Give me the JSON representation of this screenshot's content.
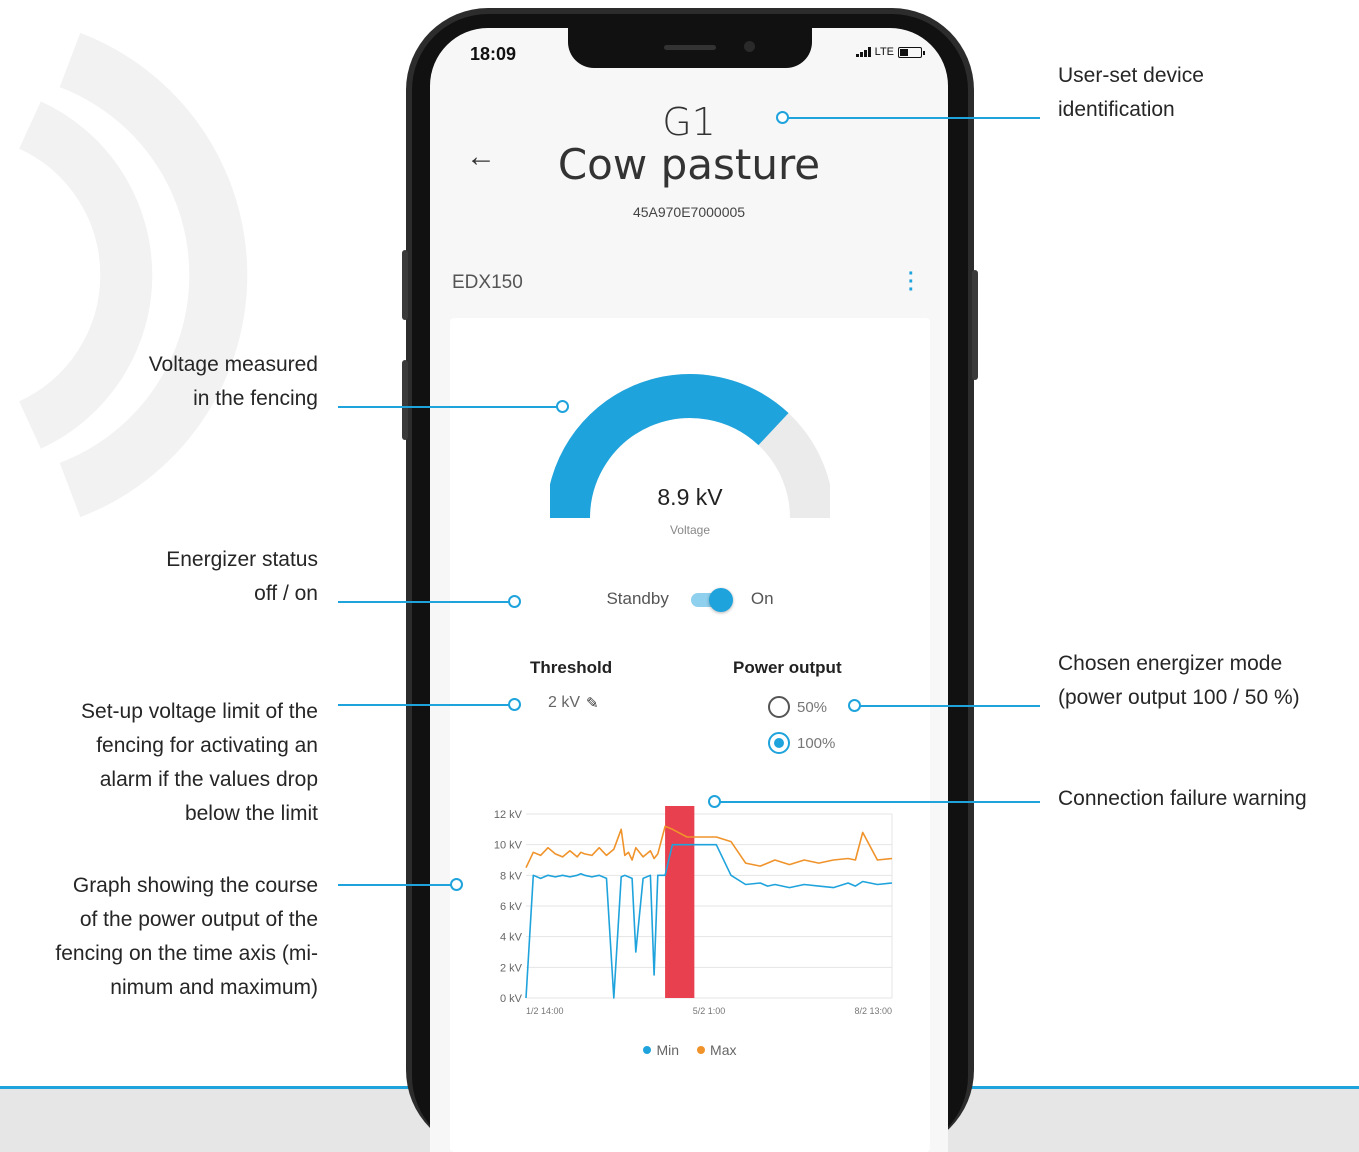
{
  "annotations": {
    "device_id": "User-set device\nidentification",
    "voltage": "Voltage measured\nin the fencing",
    "status": "Energizer status\noff / on",
    "threshold": "Set-up voltage limit of the\nfencing for activating an\nalarm if the values drop\nbelow the limit",
    "graph": "Graph showing the course\nof the power output of the\nfencing on the time axis (mi-\nnimum and maximum)",
    "mode": "Chosen energizer mode\n(power output 100 / 50 %)",
    "failure": "Connection failure warning"
  },
  "status_bar": {
    "time": "18:09",
    "network": "LTE"
  },
  "header": {
    "back_icon": "arrow-left-icon",
    "device_id": "G1",
    "device_name": "Cow pasture",
    "serial": "45A970E7000005"
  },
  "device": {
    "model": "EDX150",
    "menu_icon": "more-vertical-icon"
  },
  "gauge": {
    "value": "8.9 kV",
    "label": "Voltage",
    "fraction": 0.74
  },
  "energizer": {
    "off_label": "Standby",
    "on_label": "On",
    "state": "on"
  },
  "threshold": {
    "title": "Threshold",
    "value": "2 kV",
    "icon": "pencil-icon"
  },
  "power_output": {
    "title": "Power output",
    "options": [
      "50%",
      "100%"
    ],
    "selected": "100%"
  },
  "colors": {
    "accent": "#1fa3dc",
    "max": "#f0932b",
    "warning": "#e8404f",
    "gauge_track": "#ebebeb"
  },
  "chart_data": {
    "type": "line",
    "y_ticks": [
      "12 kV",
      "10 kV",
      "8 kV",
      "6 kV",
      "4 kV",
      "2 kV",
      "0 kV"
    ],
    "ylim": [
      0,
      12
    ],
    "x_ticks": [
      "1/2 14:00",
      "5/2 1:00",
      "8/2 13:00"
    ],
    "x": [
      0,
      2,
      4,
      6,
      8,
      10,
      12,
      14,
      15,
      16,
      18,
      20,
      22,
      24,
      26,
      27,
      28,
      29,
      30,
      32,
      34,
      35,
      36,
      38,
      40,
      44,
      48,
      52,
      56,
      60,
      64,
      66,
      68,
      72,
      76,
      80,
      84,
      88,
      90,
      92,
      96,
      100
    ],
    "series": [
      {
        "name": "Min",
        "values": [
          0,
          8,
          7.8,
          8,
          7.9,
          8,
          7.9,
          8,
          8.1,
          8,
          7.9,
          8,
          7.8,
          0,
          7.9,
          8,
          7.9,
          7.8,
          3,
          7.8,
          8,
          1.5,
          8,
          8,
          10,
          10,
          10,
          10,
          8,
          7.4,
          7.5,
          7.3,
          7.4,
          7.2,
          7.4,
          7.3,
          7.2,
          7.5,
          7.3,
          7.6,
          7.4,
          7.5
        ]
      },
      {
        "name": "Max",
        "values": [
          8.5,
          9.5,
          9.3,
          9.8,
          9.4,
          9.2,
          9.6,
          9.2,
          9.5,
          9.4,
          9.3,
          9.8,
          9.3,
          9.7,
          11,
          9.3,
          9.5,
          9.0,
          9.8,
          9.2,
          9.6,
          9.1,
          9.4,
          11.2,
          11,
          10.5,
          10.5,
          10.5,
          10.2,
          8.8,
          8.6,
          8.8,
          9.0,
          8.7,
          9.0,
          8.8,
          9.0,
          9.1,
          9.0,
          10.8,
          9.0,
          9.1
        ]
      }
    ],
    "outage": {
      "from": 38,
      "to": 46,
      "label": ""
    },
    "legend": [
      "Min",
      "Max"
    ]
  }
}
